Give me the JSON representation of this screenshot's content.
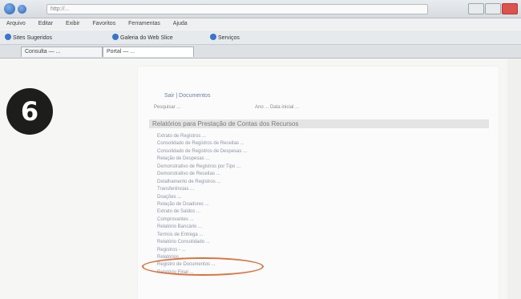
{
  "browser": {
    "address": "http://...",
    "menu": [
      "Arquivo",
      "Editar",
      "Exibir",
      "Favoritos",
      "Ferramentas",
      "Ajuda"
    ],
    "favorites": [
      {
        "label": "Sites Sugeridos"
      },
      {
        "label": "Galeria do Web Slice"
      },
      {
        "label": "Serviços"
      }
    ],
    "tabs": [
      {
        "label": "Consulta — ...",
        "active": false
      },
      {
        "label": "Portal — ...",
        "active": true
      }
    ]
  },
  "step": {
    "number": "6"
  },
  "page": {
    "sublink": "Sair | Documentos",
    "fields": [
      "Pesquisar ...",
      "Ano ... Data inicial ..."
    ],
    "section_title": "Relatórios para Prestação de Contas dos Recursos",
    "items": [
      "Extrato de Registros ...",
      "Consolidado de Registros de Receitas ...",
      "Consolidado de Registros de Despesas ...",
      "Relação de Despesas ...",
      "Demonstrativo de Registros por Tipo ...",
      "Demonstrativo de Receitas ...",
      "Detalhamento de Registros ...",
      "Transferências ...",
      "Doações ...",
      "Relação de Doadores ...",
      "Extrato de Saldos ...",
      "Comprovantes ...",
      "Relatório Bancário ...",
      "Termos de Entrega ...",
      "Relatório Consolidado ...",
      "Registros - ...",
      "Relatórios ...",
      "Registro de Documentos ...",
      "Relatório Final ..."
    ],
    "highlighted_index": 16
  },
  "colors": {
    "highlight": "#e0703a",
    "badge": "#1d1d1b"
  }
}
